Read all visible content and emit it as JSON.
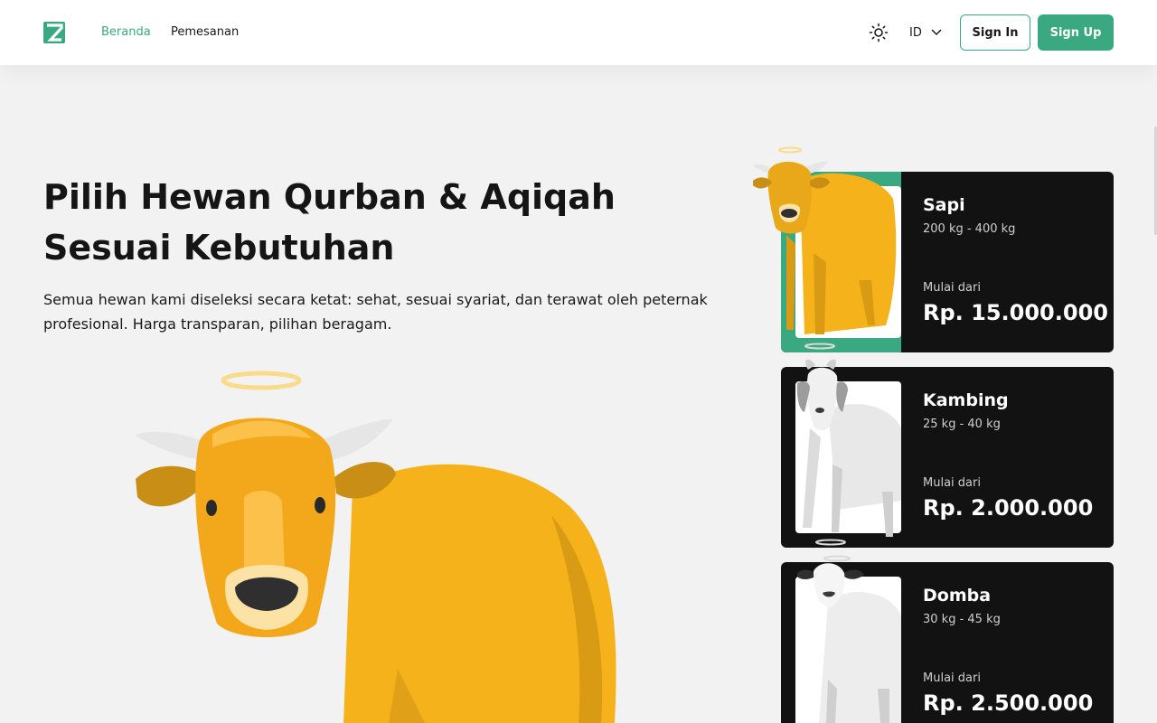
{
  "header": {
    "logo_icon": "zoo-logo-icon",
    "nav": [
      {
        "label": "Beranda",
        "active": true
      },
      {
        "label": "Pemesanan",
        "active": false
      }
    ],
    "theme_icon": "sun-icon",
    "language": "ID",
    "language_icon": "chevron-down-icon",
    "sign_in": "Sign In",
    "sign_up": "Sign Up"
  },
  "hero": {
    "title": "Pilih Hewan Qurban & Aqiqah Sesuai Kebutuhan",
    "description": "Semua hewan kami diseleksi secara ketat: sehat, sesuai syariat, dan terawat oleh peternak profesional. Harga transparan, pilihan beragam."
  },
  "cards": [
    {
      "name": "Sapi",
      "weight": "200 kg - 400 kg",
      "from_label": "Mulai dari",
      "price": "Rp. 15.000.000",
      "selected": true
    },
    {
      "name": "Kambing",
      "weight": "25 kg - 40 kg",
      "from_label": "Mulai dari",
      "price": "Rp. 2.000.000",
      "selected": false
    },
    {
      "name": "Domba",
      "weight": "30 kg - 45 kg",
      "from_label": "Mulai dari",
      "price": "Rp. 2.500.000",
      "selected": false
    }
  ],
  "colors": {
    "accent": "#3aa880",
    "card_bg": "#121212",
    "page_bg": "#f2f2f2",
    "cow": "#f5b21b"
  }
}
